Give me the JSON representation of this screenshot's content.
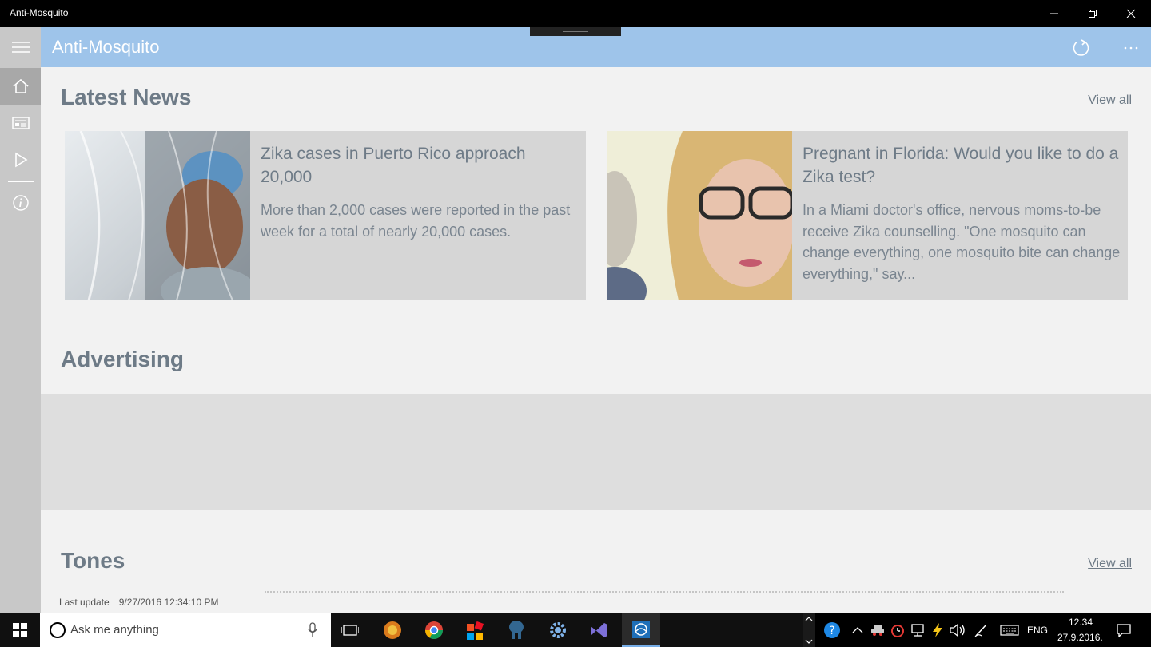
{
  "window": {
    "title": "Anti-Mosquito"
  },
  "appbar": {
    "title": "Anti-Mosquito"
  },
  "nav": {
    "items": [
      {
        "icon": "menu-icon"
      },
      {
        "icon": "home-icon"
      },
      {
        "icon": "news-icon"
      },
      {
        "icon": "play-icon"
      },
      {
        "icon": "info-icon"
      }
    ]
  },
  "latest_news": {
    "title": "Latest News",
    "view_all": "View all",
    "articles": [
      {
        "title": "Zika cases in Puerto Rico approach 20,000",
        "description": "More than 2,000 cases were reported in the past week for a total of nearly 20,000 cases."
      },
      {
        "title": "Pregnant in Florida: Would you like to do a Zika test?",
        "description": "In a Miami doctor's office, nervous moms-to-be receive Zika counselling. \"One mosquito can change everything, one mosquito bite can change everything,\" say..."
      }
    ]
  },
  "advertising": {
    "title": "Advertising"
  },
  "tones": {
    "title": "Tones",
    "view_all": "View all"
  },
  "status": {
    "label": "Last update",
    "value": "9/27/2016 12:34:10 PM"
  },
  "taskbar": {
    "search_placeholder": "Ask me anything",
    "language": "ENG",
    "time": "12.34",
    "date": "27.9.2016."
  },
  "colors": {
    "appbar": "#9ec4ea",
    "rail": "#c8c8c8",
    "content_bg": "#f2f2f2",
    "card_bg": "#d6d6d6",
    "heading_text": "#6e7b87"
  }
}
